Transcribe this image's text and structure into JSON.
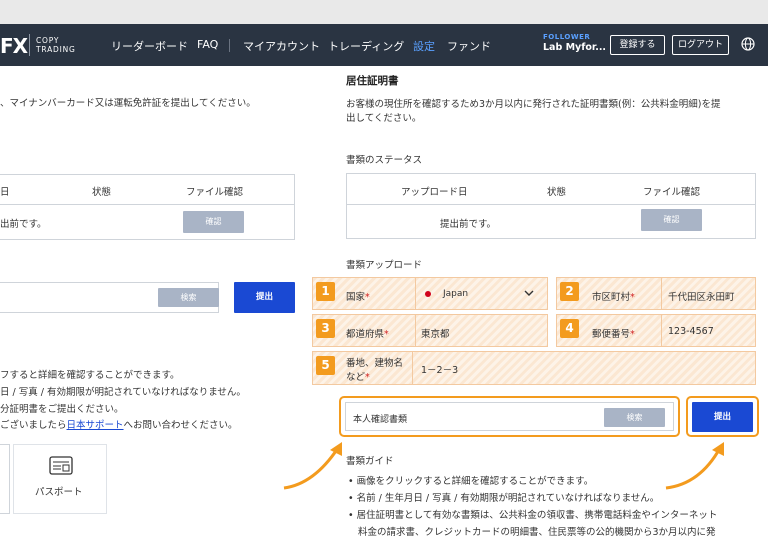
{
  "navbar": {
    "logo": "FX",
    "logo_sub_1": "COPY",
    "logo_sub_2": "TRADING",
    "items": [
      {
        "label": "リーダーボード"
      },
      {
        "label": "FAQ"
      },
      {
        "label": "マイアカウント"
      },
      {
        "label": "トレーディング"
      },
      {
        "label": "設定"
      },
      {
        "label": "ファンド"
      }
    ],
    "follower_label": "FOLLOWER",
    "user_name": "Lab Myfor...",
    "register_label": "登録する",
    "logout_label": "ログアウト",
    "globe_icon": "globe-icon",
    "active_color": "#5aa0ff"
  },
  "left": {
    "desc": "、マイナンバーカード又は運転免許証を提出してください。",
    "table_headers": [
      "日",
      "状態",
      "ファイル確認"
    ],
    "table_row_text": "出前です。",
    "confirm_label": "確認",
    "browse_label": "検索",
    "submit_label": "提出",
    "guide_lines": [
      "フすると詳細を確認することができます。",
      "日 / 写真 / 有効期限が明記されていなければなりません。",
      "分証明書をご提出ください。",
      "ございましたら"
    ],
    "support_link": "日本サポート",
    "support_suffix": "へお問い合わせください。",
    "passport_label": "パスポート",
    "passport_icon": "passport-icon"
  },
  "right": {
    "title": "居住証明書",
    "desc_1": "お客様の現住所を確認するため3か月以内に発行された証明書類(例：公共料金明細)を提",
    "desc_2": "出してください。",
    "status_title": "書類のステータス",
    "table_headers": [
      "アップロード日",
      "状態",
      "ファイル確認"
    ],
    "table_row_text": "提出前です。",
    "confirm_label": "確認",
    "upload_title": "書類アップロード",
    "fields": [
      {
        "badge": "1",
        "label": "国家",
        "value": "Japan"
      },
      {
        "badge": "2",
        "label": "市区町村",
        "value": "千代田区永田町"
      },
      {
        "badge": "3",
        "label": "都道府県",
        "value": "東京都"
      },
      {
        "badge": "4",
        "label": "郵便番号",
        "value": "123-4567"
      },
      {
        "badge": "5",
        "label_1": "番地、建物名",
        "label_2": "など",
        "value": "1－2－3"
      }
    ],
    "required_mark": "*",
    "file_placeholder": "本人確認書類",
    "browse_label": "検索",
    "submit_label": "提出",
    "guide_title": "書類ガイド",
    "guide_items": [
      "画像をクリックすると詳細を確認することができます。",
      "名前 / 生年月日 / 写真 / 有効期限が明記されていなければなりません。",
      "居住証明書として有効な書類は、公共料金の領収書、携帯電話料金やインターネット",
      "料金の請求書、クレジットカードの明細書、住民票等の公的機関から3か月以内に発"
    ],
    "bullet": "•",
    "flag_icon": "japan-flag-icon",
    "accent_color": "#f39b1e",
    "submit_color": "#1a49d3"
  }
}
